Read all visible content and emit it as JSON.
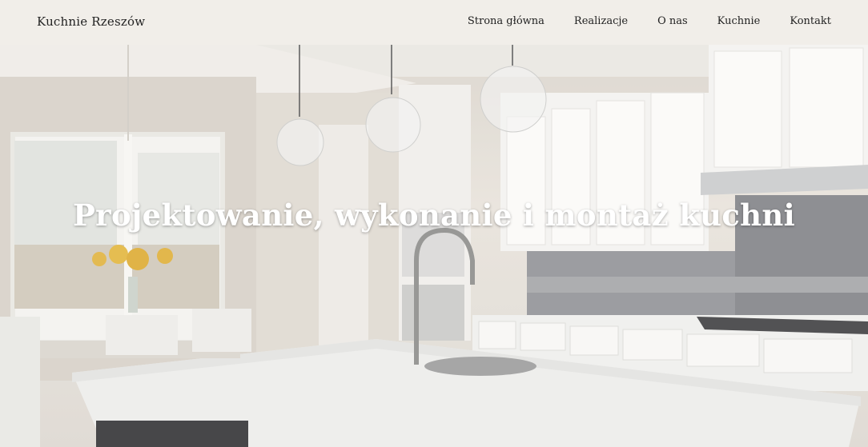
{
  "brand": "Kuchnie Rzeszów",
  "nav": [
    {
      "label": "Strona główna"
    },
    {
      "label": "Realizacje"
    },
    {
      "label": "O nas"
    },
    {
      "label": "Kuchnie"
    },
    {
      "label": "Kontakt"
    }
  ],
  "hero": {
    "headline": "Projektowanie, wykonanie i montaż kuchni",
    "overlay_color": "#ffffff"
  },
  "colors": {
    "nav_bg": "#f1eee9",
    "text": "#222222",
    "cabinet": "#f4f3f0",
    "backsplash": "#8d8d90",
    "counter": "#eeeeec"
  }
}
